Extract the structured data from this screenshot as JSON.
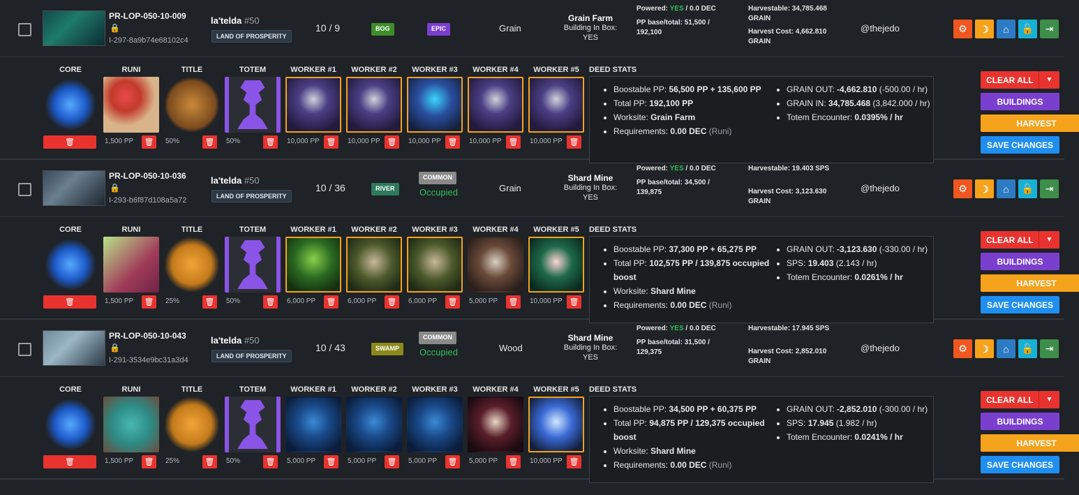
{
  "columns": {
    "core": "CORE",
    "runi": "RUNI",
    "title": "TITLE",
    "totem": "TOTEM",
    "workers": [
      "WORKER #1",
      "WORKER #2",
      "WORKER #3",
      "WORKER #4",
      "WORKER #5"
    ],
    "deed_stats": "DEED STATS"
  },
  "buttons": {
    "clear_all": "CLEAR ALL",
    "buildings": "BUILDINGS",
    "harvest": "HARVEST",
    "save_changes": "SAVE CHANGES"
  },
  "deeds": [
    {
      "plot_id": "PR-LOP-050-10-009",
      "hash": "I-297-8a9b74e68102c4",
      "region_name": "la'telda",
      "region_num": "#50",
      "land_badge": "LAND OF PROSPERITY",
      "tract": "10 / 9",
      "terrain": "BOG",
      "terrain_color": "#3f8d2a",
      "rarity": "EPIC",
      "occupied": "",
      "resource": "Grain",
      "building_name": "Grain Farm",
      "building_in_box": "Building In Box:",
      "building_in_box_value": "YES",
      "powered_label": "Powered:",
      "powered_value": "YES",
      "powered_dec": "/ 0.0 DEC",
      "pp_label": "PP base/total: 51,500 /",
      "pp_total": "192,100",
      "harvestable": "Harvestable: 34,785.468",
      "harvestable_unit": "GRAIN",
      "harvest_cost": "Harvest Cost: 4,662.810",
      "harvest_cost_unit": "GRAIN",
      "owner": "@thejedo",
      "runi_pp": "1,500 PP",
      "title_pct": "50%",
      "totem_pct": "50%",
      "workers_pp": [
        "10,000 PP",
        "10,000 PP",
        "10,000 PP",
        "10,000 PP",
        "10,000 PP"
      ],
      "stats_left": [
        {
          "label": "Boostable PP:",
          "value": "56,500 PP + 135,600 PP",
          "extra": ""
        },
        {
          "label": "Total PP:",
          "value": "192,100 PP",
          "extra": ""
        },
        {
          "label": "Worksite:",
          "value": "Grain Farm",
          "extra": ""
        },
        {
          "label": "Requirements:",
          "value": "0.00 DEC",
          "extra": "(Runi)"
        }
      ],
      "stats_right": [
        {
          "label": "GRAIN OUT:",
          "value": "-4,662.810",
          "extra": "(-500.00 / hr)"
        },
        {
          "label": "GRAIN IN:",
          "value": "34,785.468",
          "extra": "(3,842.000 / hr)"
        },
        {
          "label": "Totem Encounter:",
          "value": "0.0395% / hr",
          "extra": ""
        }
      ]
    },
    {
      "plot_id": "PR-LOP-050-10-036",
      "hash": "I-293-b6f87d108a5a72",
      "region_name": "la'telda",
      "region_num": "#50",
      "land_badge": "LAND OF PROSPERITY",
      "tract": "10 / 36",
      "terrain": "RIVER",
      "terrain_color": "#2d7a5a",
      "rarity": "COMMON",
      "occupied": "Occupied",
      "resource": "Grain",
      "building_name": "Shard Mine",
      "building_in_box": "Building In Box:",
      "building_in_box_value": "YES",
      "powered_label": "Powered:",
      "powered_value": "YES",
      "powered_dec": "/ 0.0 DEC",
      "pp_label": "PP base/total: 34,500 /",
      "pp_total": "139,875",
      "harvestable": "Harvestable: 19.403 SPS",
      "harvestable_unit": "",
      "harvest_cost": "Harvest Cost: 3,123.630",
      "harvest_cost_unit": "GRAIN",
      "owner": "@thejedo",
      "runi_pp": "1,500 PP",
      "title_pct": "25%",
      "totem_pct": "50%",
      "workers_pp": [
        "6,000 PP",
        "6,000 PP",
        "6,000 PP",
        "5,000 PP",
        "10,000 PP"
      ],
      "stats_left": [
        {
          "label": "Boostable PP:",
          "value": "37,300 PP + 65,275 PP",
          "extra": ""
        },
        {
          "label": "Total PP:",
          "value": "102,575 PP / 139,875 occupied boost",
          "extra": ""
        },
        {
          "label": "Worksite:",
          "value": "Shard Mine",
          "extra": ""
        },
        {
          "label": "Requirements:",
          "value": "0.00 DEC",
          "extra": "(Runi)"
        }
      ],
      "stats_right": [
        {
          "label": "GRAIN OUT:",
          "value": "-3,123.630",
          "extra": "(-330.00 / hr)"
        },
        {
          "label": "SPS:",
          "value": "19.403",
          "extra": "(2.143 / hr)"
        },
        {
          "label": "Totem Encounter:",
          "value": "0.0261% / hr",
          "extra": ""
        }
      ]
    },
    {
      "plot_id": "PR-LOP-050-10-043",
      "hash": "I-291-3534e9bc31a3d4",
      "region_name": "la'telda",
      "region_num": "#50",
      "land_badge": "LAND OF PROSPERITY",
      "tract": "10 / 43",
      "terrain": "SWAMP",
      "terrain_color": "#8c8a1c",
      "rarity": "COMMON",
      "occupied": "Occupied",
      "resource": "Wood",
      "building_name": "Shard Mine",
      "building_in_box": "Building In Box:",
      "building_in_box_value": "YES",
      "powered_label": "Powered:",
      "powered_value": "YES",
      "powered_dec": "/ 0.0 DEC",
      "pp_label": "PP base/total: 31,500 /",
      "pp_total": "129,375",
      "harvestable": "Harvestable: 17.945 SPS",
      "harvestable_unit": "",
      "harvest_cost": "Harvest Cost: 2,852.010",
      "harvest_cost_unit": "GRAIN",
      "owner": "@thejedo",
      "runi_pp": "1,500 PP",
      "title_pct": "25%",
      "totem_pct": "50%",
      "workers_pp": [
        "5,000 PP",
        "5,000 PP",
        "5,000 PP",
        "5,000 PP",
        "10,000 PP"
      ],
      "stats_left": [
        {
          "label": "Boostable PP:",
          "value": "34,500 PP + 60,375 PP",
          "extra": ""
        },
        {
          "label": "Total PP:",
          "value": "94,875 PP / 129,375 occupied boost",
          "extra": ""
        },
        {
          "label": "Worksite:",
          "value": "Shard Mine",
          "extra": ""
        },
        {
          "label": "Requirements:",
          "value": "0.00 DEC",
          "extra": "(Runi)"
        }
      ],
      "stats_right": [
        {
          "label": "GRAIN OUT:",
          "value": "-2,852.010",
          "extra": "(-300.00 / hr)"
        },
        {
          "label": "SPS:",
          "value": "17.945",
          "extra": "(1.982 / hr)"
        },
        {
          "label": "Totem Encounter:",
          "value": "0.0241% / hr",
          "extra": ""
        }
      ]
    }
  ]
}
